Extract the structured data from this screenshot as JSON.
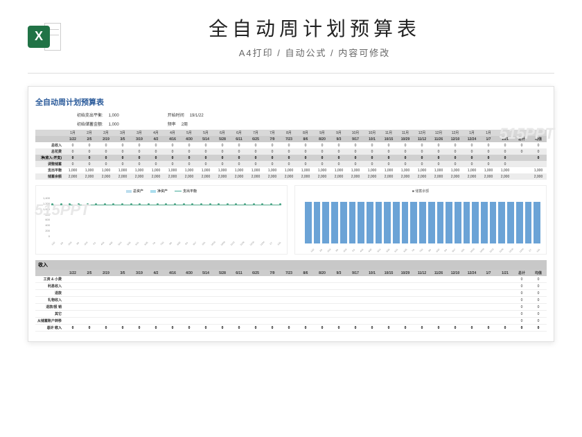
{
  "header": {
    "main_title": "全自动周计划预算表",
    "sub_title": "A4打印 / 自动公式 / 内容可修改"
  },
  "watermark": "515PPT",
  "sheet": {
    "title": "全自动周计划预算表",
    "params": {
      "balance_label": "初始支出平衡:",
      "balance_value": "1,000",
      "savings_label": "初始储蓄金额:",
      "savings_value": "1,000",
      "start_label": "开始时间",
      "start_value": "19/1/22",
      "freq_label": "频率",
      "freq_value": "2周"
    },
    "months": [
      "1月",
      "2月",
      "2月",
      "3月",
      "3月",
      "4月",
      "4月",
      "5月",
      "5月",
      "6月",
      "6月",
      "7月",
      "7月",
      "8月",
      "8月",
      "9月",
      "9月",
      "10月",
      "10月",
      "11月",
      "11月",
      "12月",
      "12月",
      "12月",
      "1月",
      "1月"
    ],
    "dates": [
      "1/22",
      "2/5",
      "2/19",
      "3/5",
      "3/19",
      "4/2",
      "4/16",
      "4/30",
      "5/14",
      "5/28",
      "6/11",
      "6/25",
      "7/9",
      "7/23",
      "8/6",
      "8/20",
      "9/3",
      "9/17",
      "10/1",
      "10/15",
      "10/29",
      "11/12",
      "11/26",
      "12/10",
      "12/24",
      "1/7",
      "1/21",
      "总计",
      "均值"
    ],
    "rows": [
      {
        "label": "总收入",
        "vals": [
          "0",
          "0",
          "0",
          "0",
          "0",
          "0",
          "0",
          "0",
          "0",
          "0",
          "0",
          "0",
          "0",
          "0",
          "0",
          "0",
          "0",
          "0",
          "0",
          "0",
          "0",
          "0",
          "0",
          "0",
          "0",
          "0",
          "0",
          "0",
          "0"
        ]
      },
      {
        "label": "总花费",
        "vals": [
          "0",
          "0",
          "0",
          "0",
          "0",
          "0",
          "0",
          "0",
          "0",
          "0",
          "0",
          "0",
          "0",
          "0",
          "0",
          "0",
          "0",
          "0",
          "0",
          "0",
          "0",
          "0",
          "0",
          "0",
          "0",
          "0",
          "0",
          "0",
          "0"
        ]
      },
      {
        "label": "净(收入-开支)",
        "vals": [
          "0",
          "0",
          "0",
          "0",
          "0",
          "0",
          "0",
          "0",
          "0",
          "0",
          "0",
          "0",
          "0",
          "0",
          "0",
          "0",
          "0",
          "0",
          "0",
          "0",
          "0",
          "0",
          "0",
          "0",
          "0",
          "0",
          "0",
          "",
          "0"
        ],
        "net": true
      },
      {
        "label": "调整储蓄",
        "vals": [
          "0",
          "0",
          "0",
          "0",
          "0",
          "0",
          "0",
          "0",
          "0",
          "0",
          "0",
          "0",
          "0",
          "0",
          "0",
          "0",
          "0",
          "0",
          "0",
          "0",
          "0",
          "0",
          "0",
          "0",
          "0",
          "0",
          "0",
          "",
          ""
        ]
      },
      {
        "label": "支出平衡",
        "vals": [
          "1,000",
          "1,000",
          "1,000",
          "1,000",
          "1,000",
          "1,000",
          "1,000",
          "1,000",
          "1,000",
          "1,000",
          "1,000",
          "1,000",
          "1,000",
          "1,000",
          "1,000",
          "1,000",
          "1,000",
          "1,000",
          "1,000",
          "1,000",
          "1,000",
          "1,000",
          "1,000",
          "1,000",
          "1,000",
          "1,000",
          "1,000",
          "",
          "1,000"
        ]
      },
      {
        "label": "储蓄余额",
        "vals": [
          "2,000",
          "2,000",
          "2,000",
          "2,000",
          "2,000",
          "2,000",
          "2,000",
          "2,000",
          "2,000",
          "2,000",
          "2,000",
          "2,000",
          "2,000",
          "2,000",
          "2,000",
          "2,000",
          "2,000",
          "2,000",
          "2,000",
          "2,000",
          "2,000",
          "2,000",
          "2,000",
          "2,000",
          "2,000",
          "2,000",
          "2,000",
          "",
          "2,000"
        ]
      }
    ],
    "legend": [
      "总资产",
      "净资产",
      "支出平衡"
    ],
    "bar_title": "储蓄余额",
    "income_section": "收入",
    "income_rows": [
      "工资 & 小费",
      "利息收入",
      "退款",
      "礼物收入",
      "退款/报 销",
      "其它",
      "从储蓄账户转移"
    ],
    "income_total_label": "总计 收入"
  },
  "chart_data": [
    {
      "type": "line",
      "title": "",
      "legend": [
        "总资产",
        "净资产",
        "支出平衡"
      ],
      "x": [
        "1/22",
        "2/5",
        "2/19",
        "3/5",
        "3/19",
        "4/2",
        "4/16",
        "4/30",
        "5/14",
        "5/28",
        "6/11",
        "6/25",
        "7/9",
        "7/23",
        "8/6",
        "8/20",
        "9/3",
        "9/17",
        "10/1",
        "10/15",
        "10/29",
        "11/12",
        "11/26",
        "12/10",
        "12/24",
        "1/7",
        "1/21"
      ],
      "series": [
        {
          "name": "支出平衡",
          "values": [
            1000,
            1000,
            1000,
            1000,
            1000,
            1000,
            1000,
            1000,
            1000,
            1000,
            1000,
            1000,
            1000,
            1000,
            1000,
            1000,
            1000,
            1000,
            1000,
            1000,
            1000,
            1000,
            1000,
            1000,
            1000,
            1000,
            1000
          ]
        }
      ],
      "ylim": [
        0,
        1400
      ],
      "yticks": [
        0,
        200,
        400,
        600,
        800,
        1000,
        1200,
        1400
      ]
    },
    {
      "type": "bar",
      "title": "储蓄余额",
      "categories": [
        "1/22",
        "2/5",
        "2/19",
        "3/5",
        "3/19",
        "4/2",
        "4/16",
        "4/30",
        "5/14",
        "5/28",
        "6/11",
        "6/25",
        "7/9",
        "7/23",
        "8/6",
        "8/20",
        "9/3",
        "9/17",
        "10/1",
        "10/15",
        "10/29",
        "11/12",
        "11/26",
        "12/10",
        "12/24",
        "1/7",
        "1/21"
      ],
      "values": [
        2000,
        2000,
        2000,
        2000,
        2000,
        2000,
        2000,
        2000,
        2000,
        2000,
        2000,
        2000,
        2000,
        2000,
        2000,
        2000,
        2000,
        2000,
        2000,
        2000,
        2000,
        2000,
        2000,
        2000,
        2000,
        2000,
        2000
      ]
    }
  ]
}
